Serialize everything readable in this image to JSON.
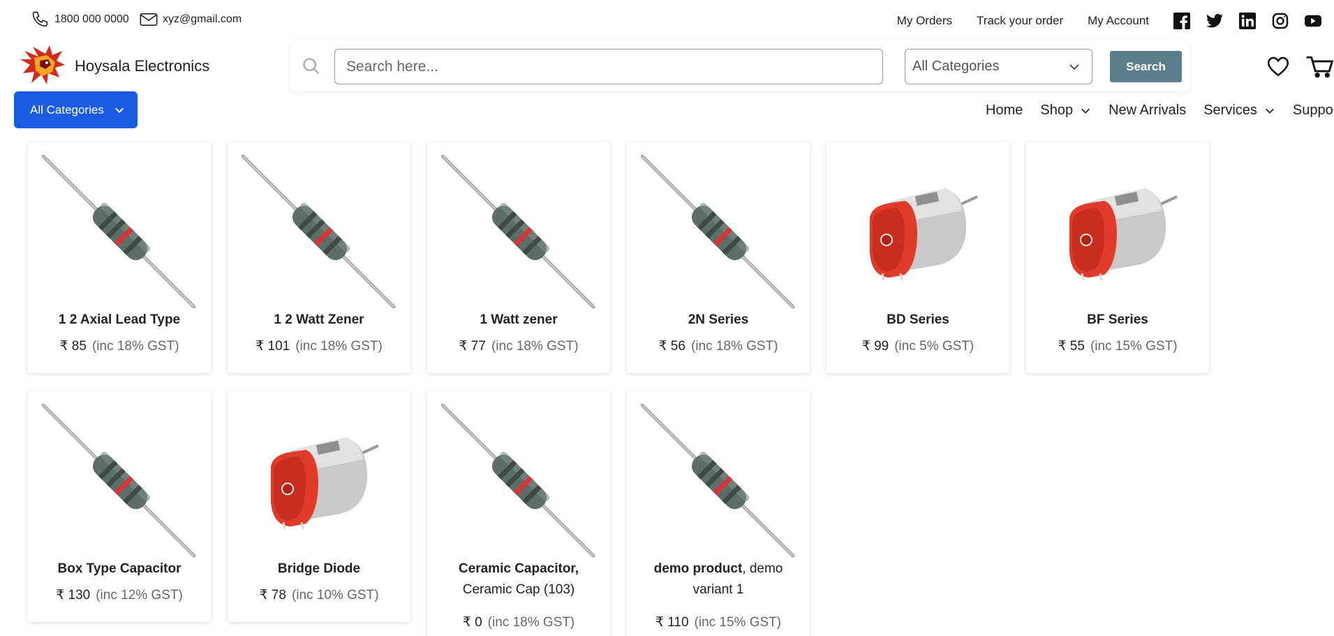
{
  "topbar": {
    "phone": "1800 000 0000",
    "email": "xyz@gmail.com",
    "links": [
      "My Orders",
      "Track your order",
      "My Account"
    ],
    "social_icons": [
      "facebook-icon",
      "twitter-icon",
      "linkedin-icon",
      "instagram-icon",
      "youtube-icon"
    ]
  },
  "header": {
    "brand": "Hoysala Electronics",
    "search_placeholder": "Search here...",
    "category_select": "All Categories",
    "search_button": "Search"
  },
  "nav": {
    "all_categories": "All Categories",
    "links": [
      "Home",
      "Shop",
      "New Arrivals",
      "Services",
      "Support"
    ]
  },
  "colors": {
    "primary_blue": "#1b5be3",
    "search_button": "#5a7e8c",
    "resistor_body": "#5c6e66",
    "motor_red": "#e03a2a"
  },
  "products": [
    {
      "name_bold": "1 2 Axial Lead Type",
      "name_regular": "",
      "price": "₹ 85",
      "tax": "(inc 18% GST)",
      "image": "resistor"
    },
    {
      "name_bold": "1 2 Watt Zener",
      "name_regular": "",
      "price": "₹ 101",
      "tax": "(inc 18% GST)",
      "image": "resistor"
    },
    {
      "name_bold": "1 Watt zener",
      "name_regular": "",
      "price": "₹ 77",
      "tax": "(inc 18% GST)",
      "image": "resistor"
    },
    {
      "name_bold": "2N Series",
      "name_regular": "",
      "price": "₹ 56",
      "tax": "(inc 18% GST)",
      "image": "resistor"
    },
    {
      "name_bold": "BD Series",
      "name_regular": "",
      "price": "₹ 99",
      "tax": "(inc 5% GST)",
      "image": "motor"
    },
    {
      "name_bold": "BF Series",
      "name_regular": "",
      "price": "₹ 55",
      "tax": "(inc 15% GST)",
      "image": "motor"
    },
    {
      "name_bold": "Box Type Capacitor",
      "name_regular": "",
      "price": "₹ 130",
      "tax": "(inc 12% GST)",
      "image": "resistor"
    },
    {
      "name_bold": "Bridge Diode",
      "name_regular": "",
      "price": "₹ 78",
      "tax": "(inc 10% GST)",
      "image": "motor"
    },
    {
      "name_bold": "Ceramic Capacitor,",
      "name_regular": " Ceramic Cap (103)",
      "price": "₹ 0",
      "tax": "(inc 18% GST)",
      "image": "resistor"
    },
    {
      "name_bold": "demo product",
      "name_regular": ", demo variant 1",
      "price": "₹ 110",
      "tax": "(inc 15% GST)",
      "image": "resistor"
    }
  ]
}
